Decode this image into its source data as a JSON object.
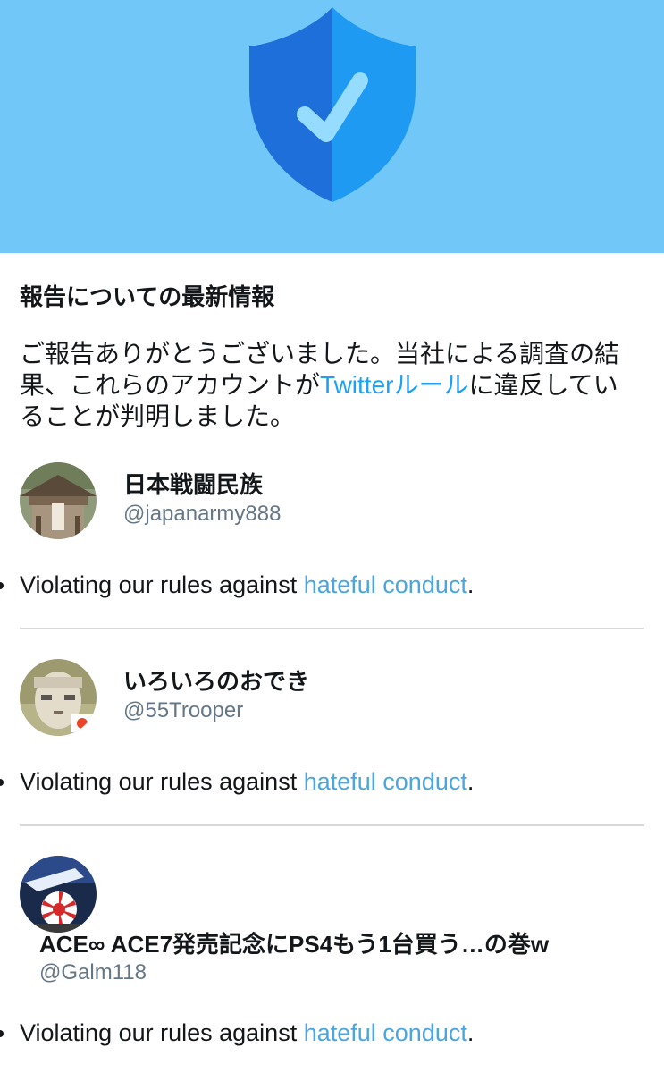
{
  "header": {
    "icon": "shield-check-icon",
    "background_color": "#71c7f7"
  },
  "report": {
    "title": "報告についての最新情報",
    "message_line1": "ご報告ありがとうございました。当社による調査の結",
    "message_line2_before": "果、これらのアカウントが",
    "message_line2_link": "Twitterルール",
    "message_line2_after": "に違反してい",
    "message_line3": "ることが判明しました。"
  },
  "accounts": [
    {
      "display_name": "日本戦闘民族",
      "handle": "@japanarmy888",
      "violation_prefix": "Violating our rules against ",
      "violation_link": "hateful conduct",
      "violation_suffix": "."
    },
    {
      "display_name": "いろいろのおでき",
      "handle": "@55Trooper",
      "violation_prefix": "Violating our rules against ",
      "violation_link": "hateful conduct",
      "violation_suffix": "."
    },
    {
      "display_name": "ACE∞ ACE7発売記念にPS4もう1台買う…の巻w",
      "handle": "@Galm118",
      "violation_prefix": "Violating our rules against ",
      "violation_link": "hateful conduct",
      "violation_suffix": "."
    }
  ],
  "colors": {
    "link": "#1da1f2",
    "handle": "#657786",
    "divider": "#d8d8d8"
  }
}
